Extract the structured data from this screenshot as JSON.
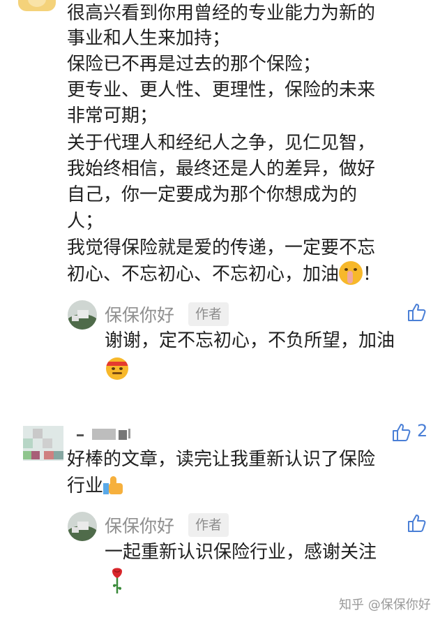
{
  "comment1": {
    "lines": [
      "很高兴看到你用曾经的专业能力为新的",
      "事业和人生来加持；",
      "保险已不再是过去的那个保险；",
      "更专业、更人性、更理性，保险的未来",
      "非常可期；",
      "关于代理人和经纪人之争，见仁见智，",
      "我始终相信，最终还是人的差异，做好",
      "自己，你一定要成为那个你想成为的",
      "人；",
      "我觉得保险就是爱的传递，一定要不忘",
      "初心、不忘初心、不忘初心，加油"
    ],
    "last_line_suffix": "！",
    "emoji": "shushing-face-icon",
    "reply": {
      "author": "保保你好",
      "badge": "作者",
      "text": "谢谢，定不忘初心，不负所望，加油",
      "emoji": "headband-face-icon"
    }
  },
  "comment2": {
    "author": "",
    "like_count": "2",
    "lines": [
      "好棒的文章，读完让我重新认识了保险",
      "行业"
    ],
    "emoji": "thumbs-up-icon",
    "reply": {
      "author": "保保你好",
      "badge": "作者",
      "text": "一起重新认识保险行业，感谢关注",
      "emoji": "rose-icon"
    }
  },
  "watermark": "知乎 @保保你好",
  "colors": {
    "like": "#4a7fd6",
    "text": "#1f1f1f",
    "muted": "#8f8f8f"
  }
}
